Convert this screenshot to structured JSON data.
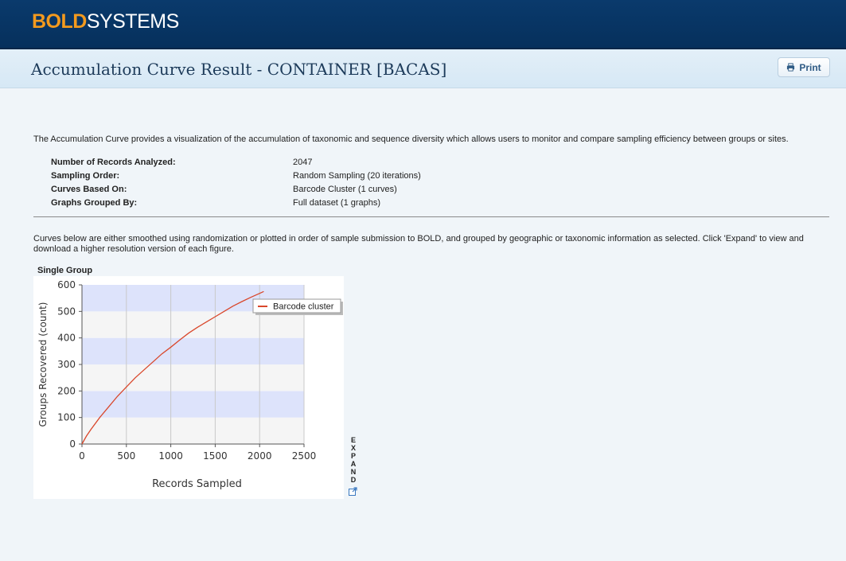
{
  "brand": {
    "part1": "BOLD",
    "part2": "SYSTEMS"
  },
  "header": {
    "title": "Accumulation Curve Result - CONTAINER [BACAS]",
    "print_label": "Print"
  },
  "intro": "The Accumulation Curve provides a visualization of the accumulation of taxonomic and sequence diversity which allows users to monitor and compare sampling efficiency between groups or sites.",
  "info": [
    {
      "label": "Number of Records Analyzed:",
      "value": "2047"
    },
    {
      "label": "Sampling Order:",
      "value": "Random Sampling (20 iterations)"
    },
    {
      "label": "Curves Based On:",
      "value": "Barcode Cluster (1 curves)"
    },
    {
      "label": "Graphs Grouped By:",
      "value": "Full dataset (1 graphs)"
    }
  ],
  "curves_text": "Curves below are either smoothed using randomization or plotted in order of sample submission to BOLD, and grouped by geographic or taxonomic information as selected. Click 'Expand' to view and download a higher resolution version of each figure.",
  "group_title": "Single Group",
  "expand_label": "EXPAND",
  "chart_data": {
    "type": "line",
    "xlabel": "Records Sampled",
    "ylabel": "Groups Recovered (count)",
    "xlim": [
      0,
      2500
    ],
    "ylim": [
      0,
      600
    ],
    "xticks": [
      0,
      500,
      1000,
      1500,
      2000,
      2500
    ],
    "yticks": [
      0,
      100,
      200,
      300,
      400,
      500,
      600
    ],
    "grid": true,
    "legend": "top-right",
    "series": [
      {
        "name": "Barcode cluster",
        "color": "#d9472b",
        "x": [
          0,
          50,
          100,
          200,
          300,
          400,
          500,
          600,
          700,
          800,
          900,
          1000,
          1100,
          1200,
          1300,
          1400,
          1500,
          1600,
          1700,
          1800,
          1900,
          2000,
          2047
        ],
        "y": [
          0,
          30,
          55,
          100,
          140,
          180,
          215,
          250,
          280,
          310,
          340,
          365,
          392,
          418,
          440,
          460,
          480,
          500,
          520,
          537,
          553,
          568,
          575
        ]
      }
    ]
  }
}
